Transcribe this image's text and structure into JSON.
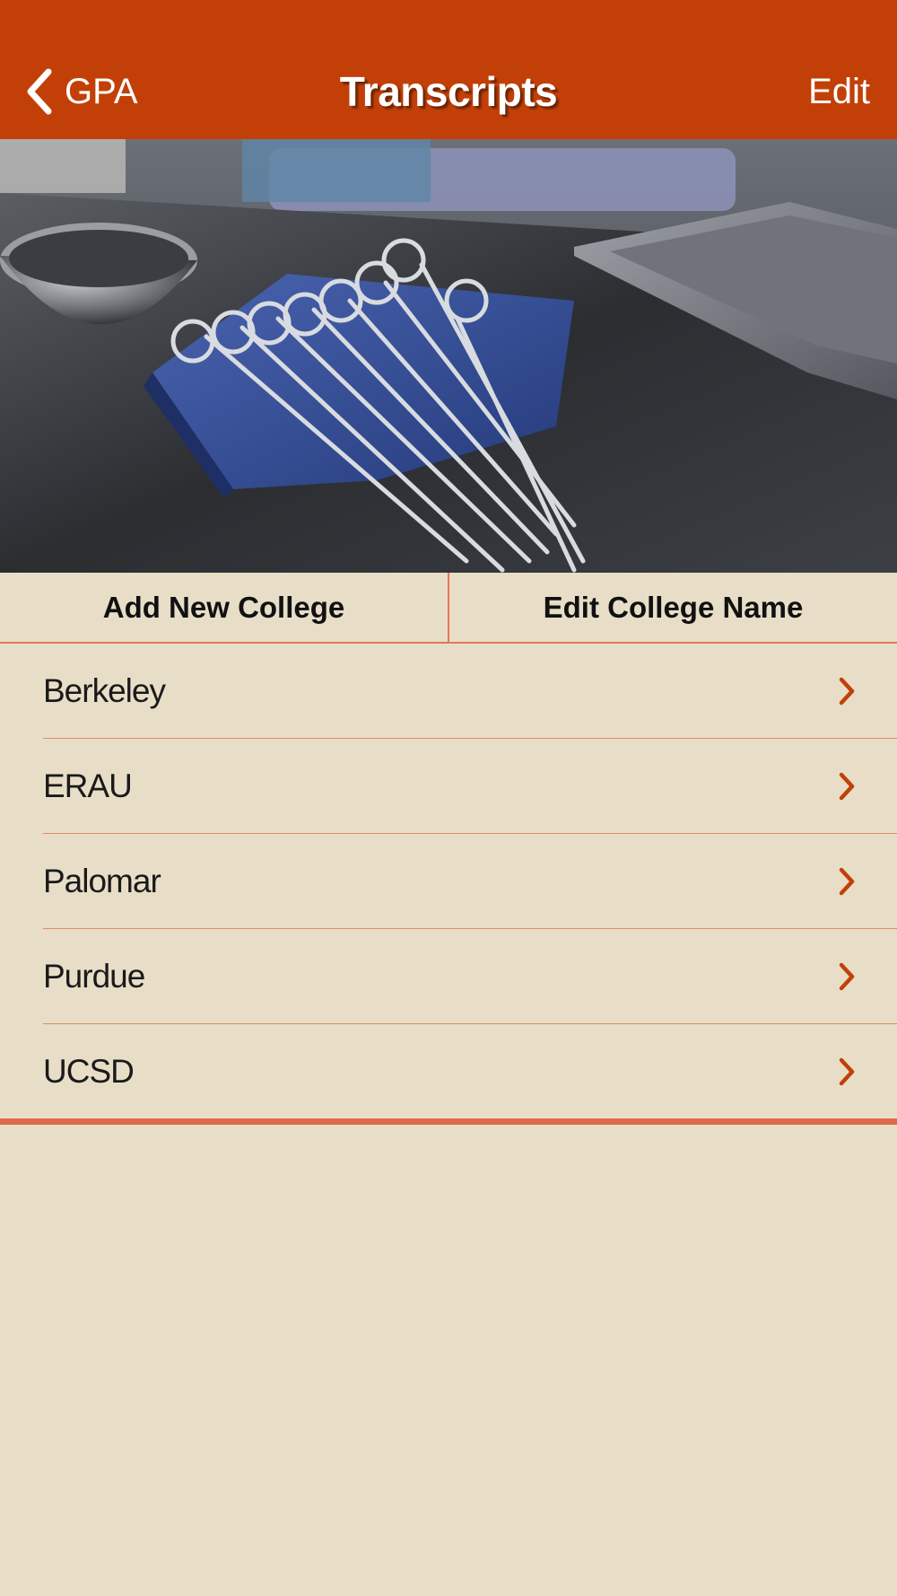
{
  "navbar": {
    "back_label": "GPA",
    "title": "Transcripts",
    "edit_label": "Edit",
    "back_icon": "chevron-left-icon",
    "background_color": "#C24008"
  },
  "hero": {
    "subject": "surgical-instruments-photo"
  },
  "actions": {
    "add_label": "Add New College",
    "edit_name_label": "Edit College Name"
  },
  "colleges": [
    {
      "name": "Berkeley"
    },
    {
      "name": "ERAU"
    },
    {
      "name": "Palomar"
    },
    {
      "name": "Purdue"
    },
    {
      "name": "UCSD"
    }
  ],
  "theme": {
    "background": "#E8DEC8",
    "accent": "#C24008",
    "separator": "#E08A66",
    "chevron_icon": "chevron-right-icon"
  }
}
